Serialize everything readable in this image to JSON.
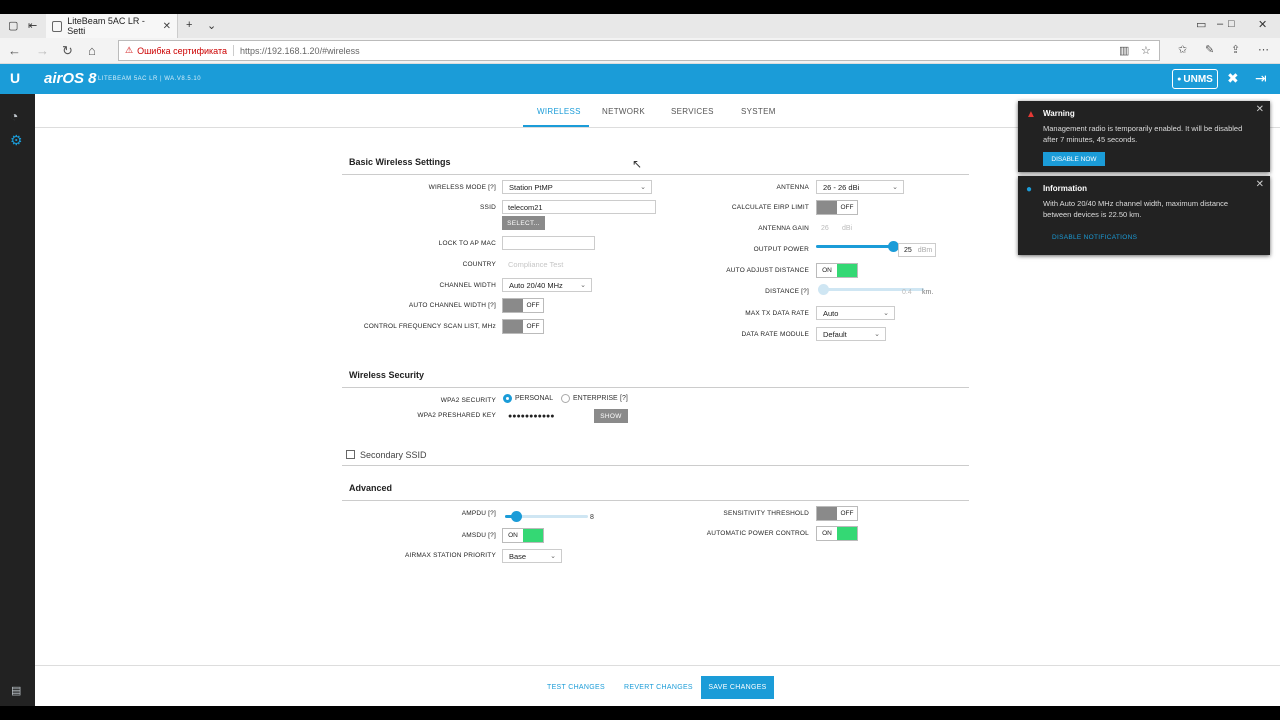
{
  "browser": {
    "tab_title": "LiteBeam 5AC LR - Setti",
    "cert_warning": "Ошибка сертификата",
    "url": "https://192.168.1.20/#wireless"
  },
  "header": {
    "product": "airOS 8",
    "model": "LITEBEAM 5AC LR | WA.V8.5.10",
    "unms": "UNMS"
  },
  "subnav": {
    "tabs": [
      "WIRELESS",
      "NETWORK",
      "SERVICES",
      "SYSTEM"
    ],
    "active": "WIRELESS"
  },
  "basic": {
    "title": "Basic Wireless Settings",
    "wireless_mode_label": "WIRELESS MODE [?]",
    "wireless_mode": "Station PtMP",
    "ssid_label": "SSID",
    "ssid": "telecom21",
    "select_btn": "SELECT...",
    "lock_ap_label": "LOCK TO AP MAC",
    "country_label": "COUNTRY",
    "country": "Compliance Test",
    "channel_width_label": "CHANNEL WIDTH",
    "channel_width": "Auto 20/40 MHz",
    "auto_channel_label": "AUTO CHANNEL WIDTH [?]",
    "auto_channel": "OFF",
    "freq_scan_label": "CONTROL FREQUENCY SCAN LIST, MHz",
    "freq_scan": "OFF",
    "antenna_label": "ANTENNA",
    "antenna": "26 - 26 dBi",
    "eirp_label": "CALCULATE EIRP LIMIT",
    "eirp": "OFF",
    "gain_label": "ANTENNA GAIN",
    "gain_value": "26",
    "gain_unit": "dBi",
    "output_power_label": "OUTPUT POWER",
    "output_power": "25",
    "output_power_unit": "dBm",
    "output_power_fraction": 1.0,
    "auto_distance_label": "AUTO ADJUST DISTANCE",
    "auto_distance": "ON",
    "distance_label": "DISTANCE [?]",
    "distance_value": "0.4",
    "distance_unit": "km.",
    "max_tx_label": "MAX TX DATA RATE",
    "max_tx": "Auto",
    "rate_module_label": "DATA RATE MODULE",
    "rate_module": "Default"
  },
  "security": {
    "title": "Wireless Security",
    "wpa2_label": "WPA2 SECURITY",
    "personal": "PERSONAL",
    "enterprise": "ENTERPRISE",
    "help": "[?]",
    "psk_label": "WPA2 PRESHARED KEY",
    "psk": "●●●●●●●●●●●",
    "show_btn": "SHOW"
  },
  "secondary": {
    "title": "Secondary SSID"
  },
  "advanced": {
    "title": "Advanced",
    "ampdu_label": "AMPDU [?]",
    "ampdu_value": "8",
    "ampdu_fraction": 0.15,
    "amsdu_label": "AMSDU [?]",
    "amsdu": "ON",
    "airmax_label": "AIRMAX STATION PRIORITY",
    "airmax": "Base",
    "sensitivity_label": "SENSITIVITY THRESHOLD",
    "sensitivity": "OFF",
    "apc_label": "AUTOMATIC POWER CONTROL",
    "apc": "ON"
  },
  "footer": {
    "test": "TEST CHANGES",
    "revert": "REVERT CHANGES",
    "save": "SAVE CHANGES"
  },
  "notifications": {
    "warning_title": "Warning",
    "warning_msg": "Management radio is temporarily enabled. It will be disabled after 7 minutes, 45 seconds.",
    "disable_now": "DISABLE NOW",
    "info_title": "Information",
    "info_msg": "With Auto 20/40 MHz channel width, maximum distance between devices is 22.50 km.",
    "disable_notifications": "DISABLE NOTIFICATIONS"
  },
  "colors": {
    "accent": "#1b9cd8",
    "on_green": "#34d874",
    "warning_red": "#e53935"
  }
}
